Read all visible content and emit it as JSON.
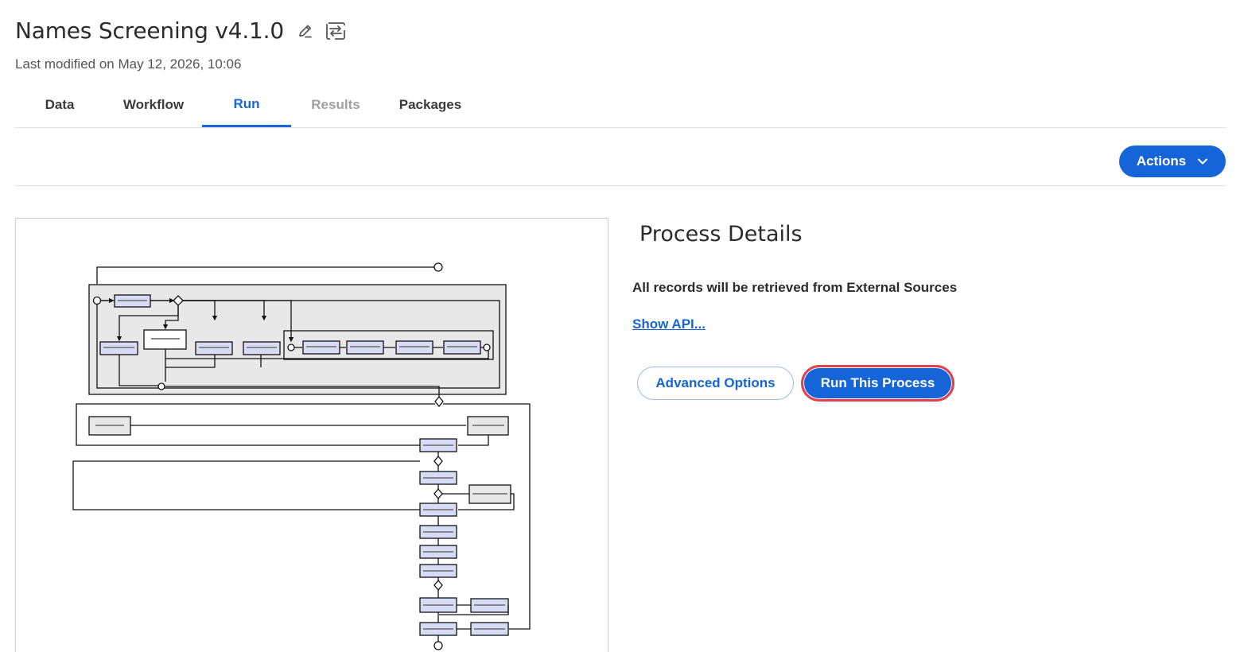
{
  "header": {
    "title": "Names Screening v4.1.0",
    "last_modified": "Last modified on May 12, 2026, 10:06",
    "edit_icon": "pencil-icon",
    "swap_icon": "swap-arrows-icon"
  },
  "tabs": [
    {
      "label": "Data",
      "state": "normal"
    },
    {
      "label": "Workflow",
      "state": "normal"
    },
    {
      "label": "Run",
      "state": "active"
    },
    {
      "label": "Results",
      "state": "disabled"
    },
    {
      "label": "Packages",
      "state": "normal"
    }
  ],
  "toolbar": {
    "actions_label": "Actions",
    "actions_icon": "chevron-down-icon"
  },
  "details": {
    "title": "Process Details",
    "info": "All records will be retrieved from External Sources",
    "api_link": "Show API...",
    "advanced_label": "Advanced Options",
    "run_label": "Run This Process"
  },
  "colors": {
    "accent": "#1565d8",
    "run_button_outline": "#e0434f",
    "diagram_task_fill": "#d6dcf5",
    "diagram_group_fill": "#e8e8e8"
  }
}
